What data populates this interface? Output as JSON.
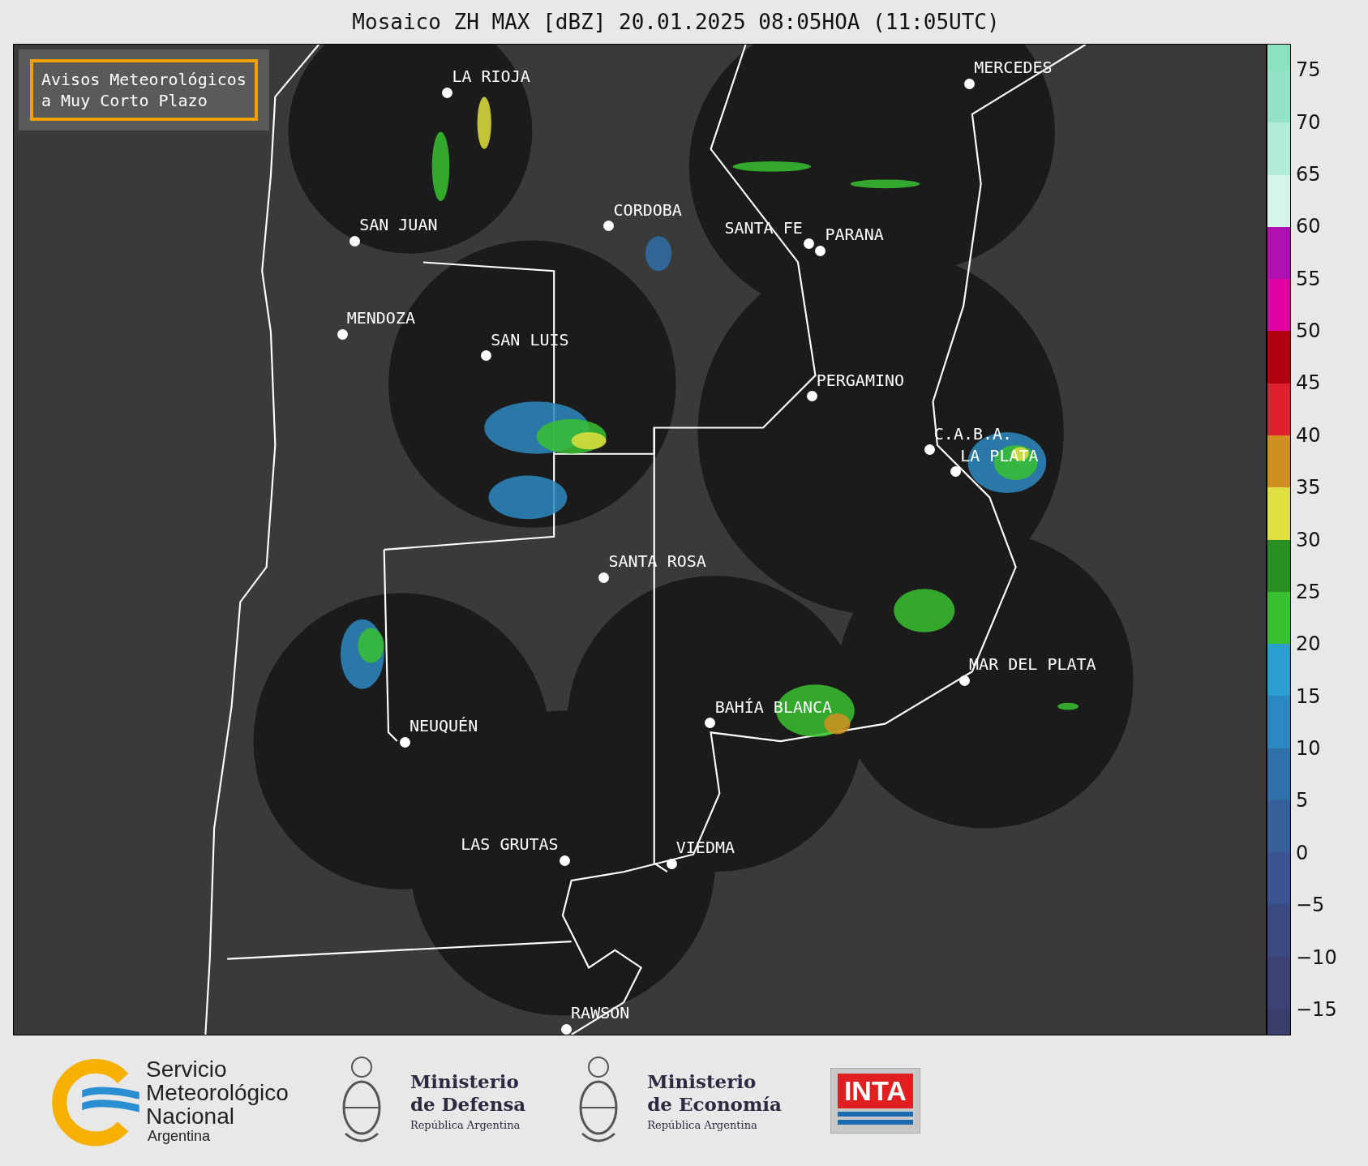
{
  "title": "Mosaico ZH MAX [dBZ] 20.01.2025 08:05HOA (11:05UTC)",
  "legend": {
    "lines": [
      "Avisos Meteorológicos",
      "a Muy Corto Plazo"
    ]
  },
  "cities": [
    {
      "name": "LA RIOJA"
    },
    {
      "name": "SAN JUAN"
    },
    {
      "name": "CORDOBA"
    },
    {
      "name": "SANTA FE"
    },
    {
      "name": "PARANA"
    },
    {
      "name": "MERCEDES"
    },
    {
      "name": "MENDOZA"
    },
    {
      "name": "SAN LUIS"
    },
    {
      "name": "PERGAMINO"
    },
    {
      "name": "C.A.B.A."
    },
    {
      "name": "LA PLATA"
    },
    {
      "name": "SANTA ROSA"
    },
    {
      "name": "MAR DEL PLATA"
    },
    {
      "name": "BAHÍA BLANCA"
    },
    {
      "name": "NEUQUÉN"
    },
    {
      "name": "LAS GRUTAS"
    },
    {
      "name": "VIEDMA"
    },
    {
      "name": "RAWSON"
    }
  ],
  "colorbar": {
    "bands": [
      {
        "color": "#8de0c0"
      },
      {
        "color": "#95e3c6"
      },
      {
        "color": "#b0ecd6"
      },
      {
        "color": "#d5f5ea"
      },
      {
        "color": "#b010b0"
      },
      {
        "color": "#e000a0"
      },
      {
        "color": "#b00010"
      },
      {
        "color": "#e02030"
      },
      {
        "color": "#d09020"
      },
      {
        "color": "#e0e040"
      },
      {
        "color": "#2a8f22"
      },
      {
        "color": "#38c030"
      },
      {
        "color": "#2aa0d0"
      },
      {
        "color": "#2c88c0"
      },
      {
        "color": "#3070a8"
      },
      {
        "color": "#37609a"
      },
      {
        "color": "#3a5490"
      },
      {
        "color": "#3b4a80"
      },
      {
        "color": "#3c4374"
      },
      {
        "color": "#3b3e6a"
      }
    ],
    "ticks": [
      "75",
      "70",
      "65",
      "60",
      "55",
      "50",
      "45",
      "40",
      "35",
      "30",
      "25",
      "20",
      "15",
      "10",
      "5",
      "0",
      "−5",
      "−10",
      "−15"
    ]
  },
  "logos": [
    {
      "kind": "smn",
      "lines": [
        "Servicio",
        "Meteorológico",
        "Nacional"
      ],
      "sub": "Argentina"
    },
    {
      "kind": "ministry",
      "lines": [
        "Ministerio",
        "de Defensa"
      ],
      "sub": "República Argentina"
    },
    {
      "kind": "ministry",
      "lines": [
        "Ministerio",
        "de Economía"
      ],
      "sub": "República Argentina"
    },
    {
      "kind": "inta",
      "lines": [
        "INTA"
      ]
    }
  ]
}
